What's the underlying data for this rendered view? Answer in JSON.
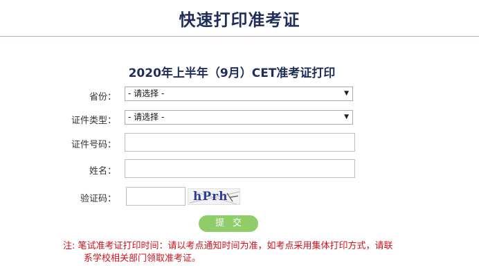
{
  "header": {
    "title": "快速打印准考证"
  },
  "form": {
    "title": "2020年上半年（9月）CET准考证打印",
    "province": {
      "label": "省份：",
      "value": "- 请选择 -"
    },
    "id_type": {
      "label": "证件类型：",
      "value": "- 请选择 -"
    },
    "id_number": {
      "label": "证件号码：",
      "value": ""
    },
    "name": {
      "label": "姓名：",
      "value": ""
    },
    "captcha": {
      "label": "验证码：",
      "value": "",
      "image_text": "hPrh"
    },
    "submit_label": "提交"
  },
  "note": {
    "line1": "注:  笔试准考证打印时间：请以考点通知时间为准，如考点采用集体打印方式，请联",
    "line2": "系学校相关部门领取准考证。"
  },
  "colors": {
    "title": "#1f2d5a",
    "button": "#8fcd68",
    "note": "#d0121b",
    "header_rule": "#c9a3c8"
  }
}
